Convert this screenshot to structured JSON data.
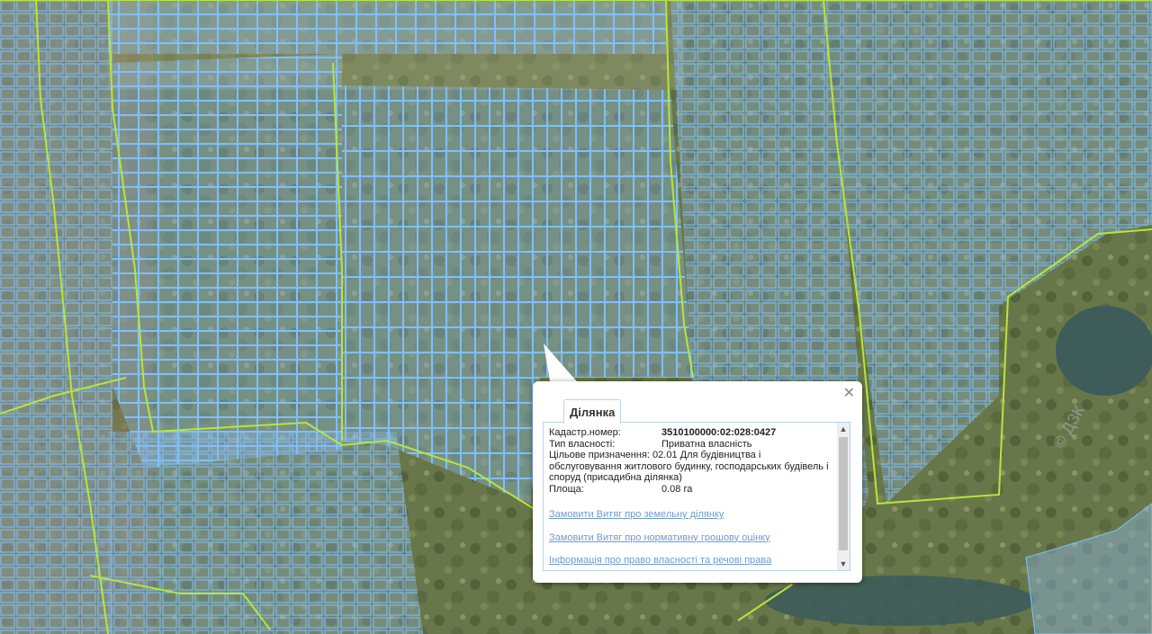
{
  "popup": {
    "tab_label": "Ділянка",
    "close_icon": "close-icon",
    "fields": [
      {
        "label": "Кадастр.номер:",
        "value": "3510100000:02:028:0427"
      },
      {
        "label": "Тип власності:",
        "value": "Приватна власність"
      },
      {
        "label": "Цільове призначення:",
        "value": "02.01 Для будівництва і обслуговування житлового будинку, господарських будівель і споруд (присадибна ділянка)"
      },
      {
        "label": "Площа:",
        "value": "0.08 га"
      }
    ],
    "links": [
      "Замовити Витяг про земельну ділянку",
      "Замовити Витяг про нормативну грошову оцінку",
      "Інформація про право власності та речові права"
    ]
  },
  "colors": {
    "parcel_fill": "#8fb9e3",
    "parcel_stroke": "#7ec0ff",
    "road_line": "#b6e63a",
    "lake": "#3d5c5a",
    "link": "#6f9ad0"
  }
}
